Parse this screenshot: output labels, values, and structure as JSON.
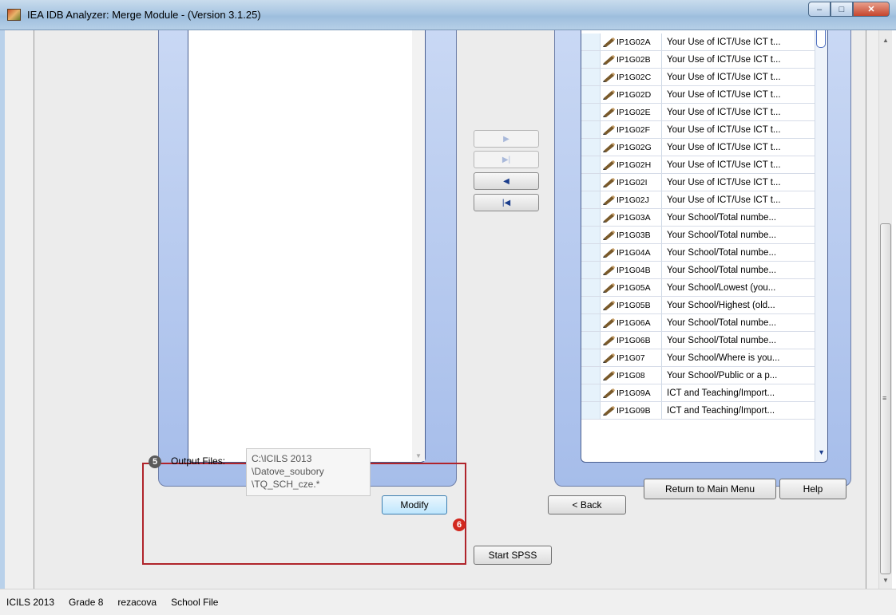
{
  "window": {
    "title": "IEA IDB Analyzer: Merge Module - (Version 3.1.25)",
    "minimize_glyph": "–",
    "maximize_glyph": "□",
    "close_glyph": "✕"
  },
  "arrows": {
    "move_right": "▶",
    "move_all_right": "▶|",
    "move_left": "◀",
    "move_all_left": "|◀"
  },
  "variables": [
    {
      "code": "IP1G02A",
      "label": "Your Use of ICT/Use ICT t..."
    },
    {
      "code": "IP1G02B",
      "label": "Your Use of ICT/Use ICT t..."
    },
    {
      "code": "IP1G02C",
      "label": "Your Use of ICT/Use ICT t..."
    },
    {
      "code": "IP1G02D",
      "label": "Your Use of ICT/Use ICT t..."
    },
    {
      "code": "IP1G02E",
      "label": "Your Use of ICT/Use ICT t..."
    },
    {
      "code": "IP1G02F",
      "label": "Your Use of ICT/Use ICT t..."
    },
    {
      "code": "IP1G02G",
      "label": "Your Use of ICT/Use ICT t..."
    },
    {
      "code": "IP1G02H",
      "label": "Your Use of ICT/Use ICT t..."
    },
    {
      "code": "IP1G02I",
      "label": "Your Use of ICT/Use ICT t..."
    },
    {
      "code": "IP1G02J",
      "label": "Your Use of ICT/Use ICT t..."
    },
    {
      "code": "IP1G03A",
      "label": "Your School/Total numbe..."
    },
    {
      "code": "IP1G03B",
      "label": "Your School/Total numbe..."
    },
    {
      "code": "IP1G04A",
      "label": "Your School/Total numbe..."
    },
    {
      "code": "IP1G04B",
      "label": "Your School/Total numbe..."
    },
    {
      "code": "IP1G05A",
      "label": "Your School/Lowest (you..."
    },
    {
      "code": "IP1G05B",
      "label": "Your School/Highest (old..."
    },
    {
      "code": "IP1G06A",
      "label": "Your School/Total numbe..."
    },
    {
      "code": "IP1G06B",
      "label": "Your School/Total numbe..."
    },
    {
      "code": "IP1G07",
      "label": "Your School/Where is you..."
    },
    {
      "code": "IP1G08",
      "label": "Your School/Public or a p..."
    },
    {
      "code": "IP1G09A",
      "label": "ICT and Teaching/Import..."
    },
    {
      "code": "IP1G09B",
      "label": "ICT and Teaching/Import..."
    }
  ],
  "output": {
    "step_number": "5",
    "label": "Output Files:",
    "path_lines": [
      "C:\\ICILS 2013",
      "\\Datove_soubory",
      "\\TQ_SCH_cze.*"
    ],
    "modify_label": "Modify"
  },
  "nav": {
    "back_label": "< Back",
    "return_label": "Return to Main Menu",
    "help_label": "Help",
    "start_step_number": "6",
    "start_label": "Start SPSS"
  },
  "status": {
    "study": "ICILS 2013",
    "grade": "Grade 8",
    "user": "rezacova",
    "file": "School File"
  },
  "colors": {
    "panel_blue": "#a6bdea",
    "highlight_red": "#b0242b",
    "step6_red": "#d2281e"
  }
}
